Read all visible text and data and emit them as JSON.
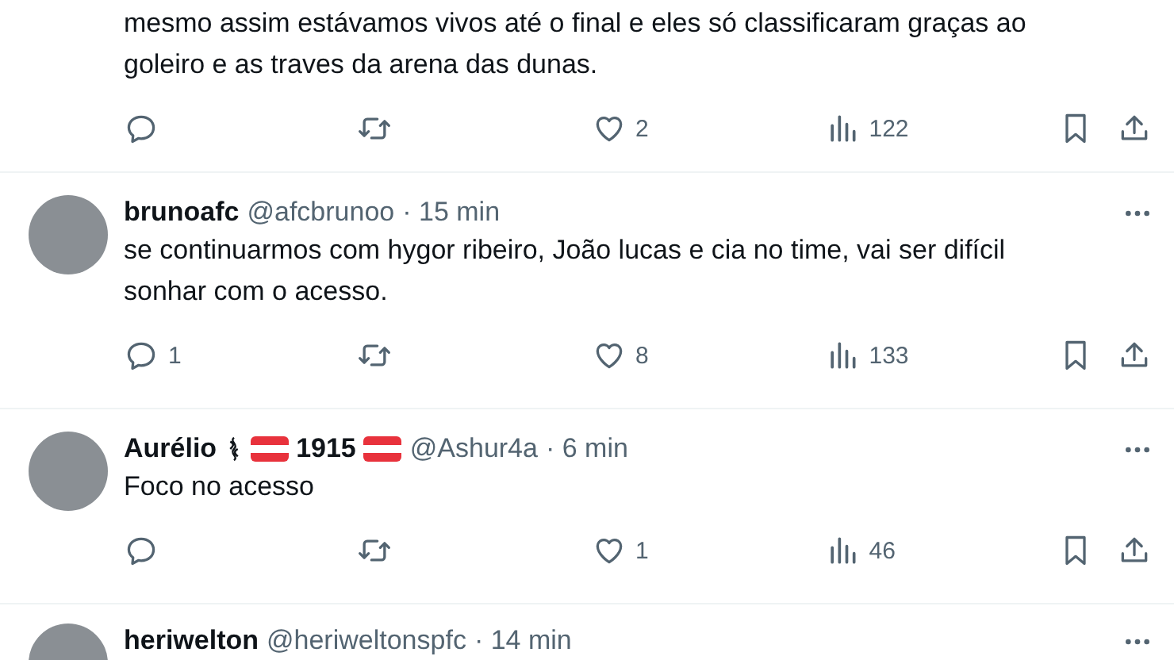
{
  "tweets": [
    {
      "body": "mesmo assim estávamos vivos até o final e eles só classificaram graças ao goleiro e as traves da arena das dunas.",
      "actions": {
        "likes": "2",
        "views": "122"
      }
    },
    {
      "author": {
        "name_parts": [
          {
            "kind": "text",
            "text": "brunoafc"
          }
        ],
        "handle": "@afcbrunoo",
        "time": "· 15 min"
      },
      "body": "se continuarmos com hygor ribeiro, João lucas e cia no time, vai ser difícil sonhar com o acesso.",
      "actions": {
        "replies": "1",
        "likes": "8",
        "views": "133"
      }
    },
    {
      "author": {
        "name_parts": [
          {
            "kind": "text",
            "text": "Aurélio"
          },
          {
            "kind": "symbol"
          },
          {
            "kind": "flag"
          },
          {
            "kind": "text",
            "text": "1915"
          },
          {
            "kind": "flag"
          }
        ],
        "handle": "@Ashur4a",
        "time": "· 6 min"
      },
      "body": "Foco no acesso",
      "actions": {
        "likes": "1",
        "views": "46"
      }
    },
    {
      "author": {
        "name_parts": [
          {
            "kind": "text",
            "text": "heriwelton"
          }
        ],
        "handle": "@heriweltonspfc",
        "time": "· 14 min"
      }
    }
  ]
}
